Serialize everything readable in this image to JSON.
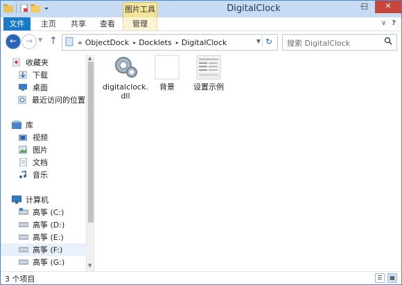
{
  "window": {
    "title": "DigitalClock",
    "context_tab": "图片工具",
    "controls": {
      "minimize": "—",
      "maximize": "□",
      "close": "✕"
    }
  },
  "ribbon": {
    "tabs": [
      "文件",
      "主页",
      "共享",
      "查看",
      "管理"
    ],
    "help": "?",
    "expand": "∨"
  },
  "address": {
    "prefix": "«",
    "breadcrumbs": [
      "ObjectDock",
      "Docklets",
      "DigitalClock"
    ],
    "separator": "▸"
  },
  "search": {
    "placeholder": "搜索 DigitalClock"
  },
  "nav": {
    "favorites": {
      "label": "收藏夹",
      "items": [
        "下载",
        "桌面",
        "最近访问的位置"
      ]
    },
    "libraries": {
      "label": "库",
      "items": [
        "视频",
        "图片",
        "文档",
        "音乐"
      ]
    },
    "computer": {
      "label": "计算机",
      "drives": [
        "高筝 (C:)",
        "高筝 (D:)",
        "高筝 (E:)",
        "高筝 (F:)",
        "高筝 (G:)"
      ]
    }
  },
  "files": [
    {
      "name": "digitalclock.dll",
      "icon": "dll-gear-icon"
    },
    {
      "name": "背景",
      "icon": "image-blank-icon"
    },
    {
      "name": "设置示例",
      "icon": "image-settings-screenshot-icon"
    }
  ],
  "status": {
    "count": "3 个项目"
  },
  "colors": {
    "accent": "#1979ca",
    "titlebar": "#c7dcf3",
    "context_tab": "#f3e399",
    "close": "#c7453b"
  }
}
